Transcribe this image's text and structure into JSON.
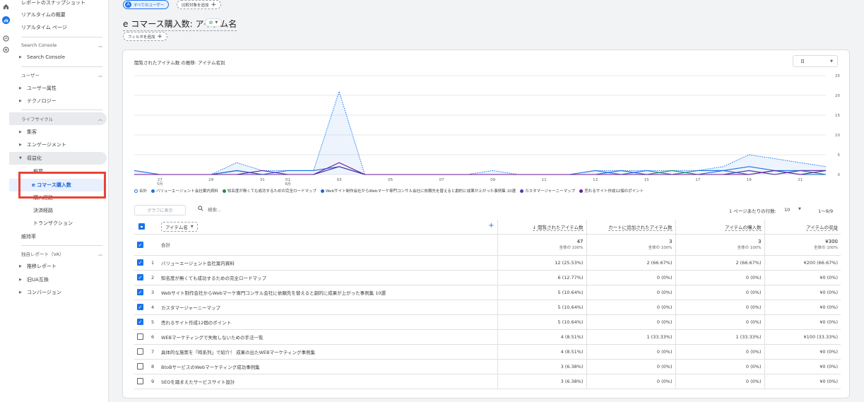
{
  "rail": [
    "home-icon",
    "reports-icon",
    "explore-icon",
    "advertising-icon"
  ],
  "sidebar": {
    "top_items": [
      "レポートのスナップショット",
      "リアルタイムの概要",
      "リアルタイム ページ"
    ],
    "sections": [
      {
        "title": "Search Console",
        "items": [
          {
            "label": "Search Console",
            "expandable": true
          }
        ]
      },
      {
        "title": "ユーザー",
        "items": [
          {
            "label": "ユーザー属性",
            "expandable": true
          },
          {
            "label": "テクノロジー",
            "expandable": true
          }
        ]
      },
      {
        "title": "ライフサイクル",
        "items": [
          {
            "label": "集客",
            "expandable": true
          },
          {
            "label": "エンゲージメント",
            "expandable": true
          },
          {
            "label": "収益化",
            "expanded": true
          }
        ]
      },
      {
        "title": "独自レポート（VA）",
        "items": [
          {
            "label": "推移レポート",
            "expandable": true
          },
          {
            "label": "旧UA互換",
            "expandable": true
          },
          {
            "label": "コンバージョン",
            "expandable": true
          }
        ]
      }
    ],
    "monetization_sub": [
      "概要",
      "e コマース購入数",
      "購入経路",
      "決済経路",
      "トランザクション"
    ],
    "retention": "維持率"
  },
  "header": {
    "all_users_chip": "すべてのユーザー",
    "compare_chip": "比較対象を追加",
    "page_title": "e コマース購入数: アイテム名",
    "filter_chip": "フィルタを追加"
  },
  "chart": {
    "title": "閲覧されたアイテム数 の推移: アイテム名別",
    "granularity": "日",
    "legend": [
      {
        "label": "合計",
        "color": "#1a73e8",
        "hollow": true
      },
      {
        "label": "バリューエージェント会社案内資料",
        "color": "#1a73e8"
      },
      {
        "label": "知名度が無くても成功するための完全ロードマップ",
        "color": "#1e8e3e"
      },
      {
        "label": "Webサイト制作会社からWebマーケ専門コンサル会社に依頼先を替えると劇的に成果が上がった事例集 10選",
        "color": "#1967d2"
      },
      {
        "label": "カスタマージャーニーマップ",
        "color": "#5e35b1"
      },
      {
        "label": "売れるサイト作成12個のポイント",
        "color": "#6a1b9a"
      }
    ]
  },
  "chart_data": {
    "type": "line",
    "x": [
      "5/26",
      "5/27",
      "5/28",
      "5/29",
      "5/30",
      "5/31",
      "6/1",
      "6/2",
      "6/3",
      "6/4",
      "6/5",
      "6/6",
      "6/7",
      "6/8",
      "6/9",
      "6/10",
      "6/11",
      "6/12",
      "6/13",
      "6/14",
      "6/15",
      "6/16",
      "6/17",
      "6/18",
      "6/19",
      "6/20",
      "6/21",
      "6/22"
    ],
    "x_ticks": [
      "27",
      "29",
      "31",
      "01",
      "03",
      "05",
      "07",
      "09",
      "11",
      "13",
      "15",
      "17",
      "19",
      "21"
    ],
    "x_tick_sub": {
      "27": "5月",
      "01": "6月"
    },
    "ylim": [
      0,
      25
    ],
    "y_ticks": [
      0,
      5,
      10,
      15,
      20,
      25
    ],
    "series": [
      {
        "name": "合計",
        "color": "#1a73e8",
        "dashed": true,
        "values": [
          1,
          0,
          0,
          0,
          3,
          1,
          1,
          1,
          21,
          0,
          0,
          0,
          0,
          0,
          1,
          0,
          0,
          0,
          1,
          1,
          1,
          1,
          1,
          2,
          5,
          4,
          3,
          2
        ]
      },
      {
        "name": "バリューエージェント会社案内資料",
        "color": "#1a73e8",
        "values": [
          1,
          0,
          0,
          0,
          1,
          0,
          1,
          1,
          2,
          0,
          0,
          0,
          0,
          0,
          0,
          0,
          0,
          0,
          1,
          0,
          1,
          0,
          1,
          1,
          2,
          1,
          1,
          1
        ]
      },
      {
        "name": "知名度が無くても成功するための完全ロードマップ",
        "color": "#1e8e3e",
        "values": [
          0,
          0,
          0,
          0,
          1,
          0,
          0,
          0,
          2,
          0,
          0,
          0,
          0,
          0,
          0,
          0,
          0,
          0,
          0,
          0,
          0,
          1,
          0,
          0,
          1,
          0,
          1,
          0
        ]
      },
      {
        "name": "Webサイト制作会社からWebマーケ専門コンサル会社に依頼先を替えると劇的に成果が上がった事例集 10選",
        "color": "#1967d2",
        "values": [
          0,
          0,
          0,
          0,
          1,
          0,
          0,
          0,
          2,
          0,
          0,
          0,
          0,
          0,
          0,
          0,
          0,
          0,
          0,
          1,
          0,
          0,
          0,
          1,
          0,
          1,
          0,
          0
        ]
      },
      {
        "name": "カスタマージャーニーマップ",
        "color": "#5e35b1",
        "values": [
          0,
          0,
          0,
          0,
          0,
          0,
          0,
          0,
          2,
          0,
          0,
          0,
          0,
          0,
          0,
          0,
          0,
          0,
          0,
          0,
          0,
          0,
          0,
          0,
          1,
          0,
          1,
          1
        ]
      },
      {
        "name": "売れるサイト作成12個のポイント",
        "color": "#6a1b9a",
        "values": [
          0,
          0,
          0,
          0,
          0,
          1,
          0,
          0,
          3,
          0,
          0,
          0,
          0,
          0,
          0,
          0,
          0,
          0,
          0,
          0,
          0,
          0,
          0,
          0,
          0,
          1,
          0,
          1
        ]
      }
    ]
  },
  "table": {
    "graph_button": "グラフに表示",
    "search_placeholder": "検索...",
    "rows_per_page_label": "1 ページあたりの行数:",
    "rows_per_page": "10",
    "range": "1〜9/9",
    "dimension": "アイテム名",
    "columns": [
      "↓ 閲覧されたアイテム数",
      "カートに追加されたアイテム数",
      "アイテムの購入数",
      "アイテムの収益"
    ],
    "total": {
      "label": "合計",
      "values": [
        "47",
        "3",
        "3",
        "¥300"
      ],
      "subs": [
        "全体の 100%",
        "全体の 100%",
        "全体の 100%",
        "全体の 100%"
      ]
    },
    "rows": [
      {
        "n": "1",
        "checked": true,
        "name": "バリューエージェント会社案内資料",
        "v": [
          "12 (25.53%)",
          "2 (66.67%)",
          "2 (66.67%)",
          "¥200 (66.67%)"
        ]
      },
      {
        "n": "2",
        "checked": true,
        "name": "知名度が無くても成功するための完全ロードマップ",
        "v": [
          "6 (12.77%)",
          "0 (0%)",
          "0 (0%)",
          "¥0 (0%)"
        ]
      },
      {
        "n": "3",
        "checked": true,
        "name": "Webサイト制作会社からWebマーケ専門コンサル会社に依頼先を替えると劇的に成果が上がった事例集 10選",
        "v": [
          "5 (10.64%)",
          "0 (0%)",
          "0 (0%)",
          "¥0 (0%)"
        ]
      },
      {
        "n": "4",
        "checked": true,
        "name": "カスタマージャーニーマップ",
        "v": [
          "5 (10.64%)",
          "0 (0%)",
          "0 (0%)",
          "¥0 (0%)"
        ]
      },
      {
        "n": "5",
        "checked": true,
        "name": "売れるサイト作成12個のポイント",
        "v": [
          "5 (10.64%)",
          "0 (0%)",
          "0 (0%)",
          "¥0 (0%)"
        ]
      },
      {
        "n": "6",
        "checked": false,
        "name": "WEBマーケティングで失敗しないための手法一覧",
        "v": [
          "4 (8.51%)",
          "1 (33.33%)",
          "1 (33.33%)",
          "¥100 (33.33%)"
        ]
      },
      {
        "n": "7",
        "checked": false,
        "name": "具体的な施策を「時系列」で紹介！ 成果の出たWEBマーケティング事例集",
        "v": [
          "4 (8.51%)",
          "0 (0%)",
          "0 (0%)",
          "¥0 (0%)"
        ]
      },
      {
        "n": "8",
        "checked": false,
        "name": "BtoBサービスのWebマーケティング成功事例集",
        "v": [
          "3 (6.38%)",
          "0 (0%)",
          "0 (0%)",
          "¥0 (0%)"
        ]
      },
      {
        "n": "9",
        "checked": false,
        "name": "SEOを踏まえたサービスサイト設計",
        "v": [
          "3 (6.38%)",
          "0 (0%)",
          "0 (0%)",
          "¥0 (0%)"
        ]
      }
    ]
  }
}
